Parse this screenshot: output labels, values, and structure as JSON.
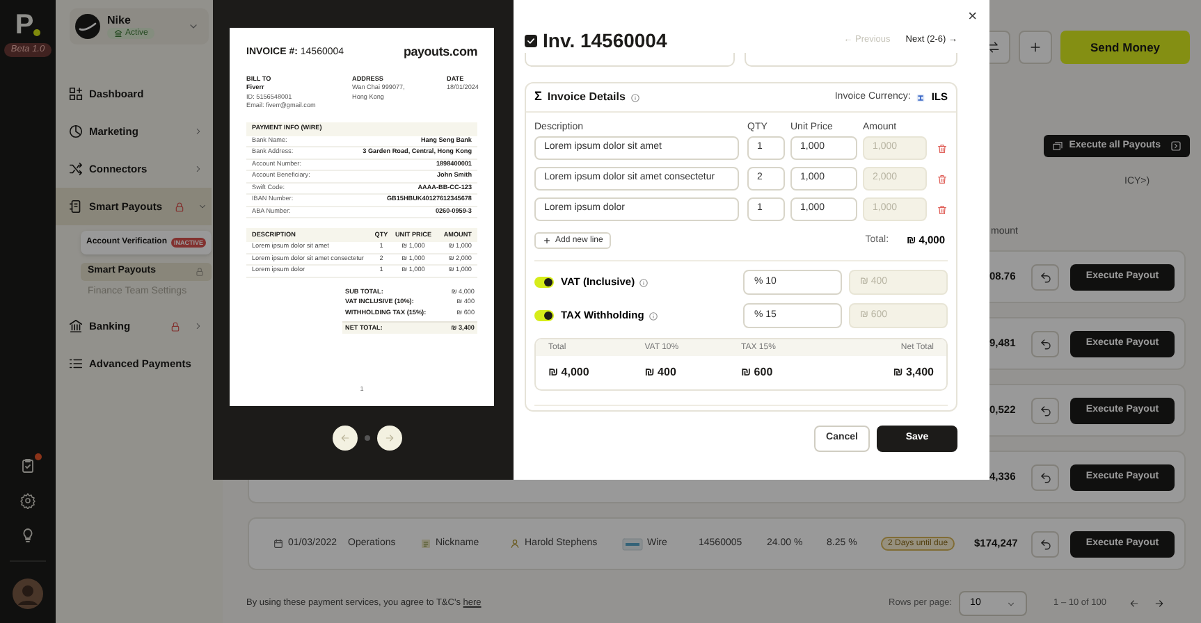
{
  "rail": {
    "logo": "P",
    "version": "Beta 1.0",
    "notification": true
  },
  "account": {
    "name": "Nike",
    "status": "Active"
  },
  "nav": [
    {
      "label": "Dashboard",
      "expandable": false,
      "expanded": false,
      "locked": false,
      "selected": false
    },
    {
      "label": "Marketing",
      "expandable": true,
      "expanded": false,
      "locked": false,
      "selected": false
    },
    {
      "label": "Connectors",
      "expandable": true,
      "expanded": false,
      "locked": false,
      "selected": false
    },
    {
      "label": "Smart Payouts",
      "expandable": true,
      "expanded": true,
      "locked": true,
      "selected": true,
      "children": [
        {
          "label": "Account Verification",
          "kind": "card",
          "badge": "INACTIVE",
          "locked": false,
          "selected": false,
          "disabled": false
        },
        {
          "label": "Smart Payouts",
          "kind": "link",
          "locked": true,
          "selected": true,
          "disabled": false
        },
        {
          "label": "Finance Team Settings",
          "kind": "link",
          "locked": false,
          "selected": false,
          "disabled": true
        }
      ]
    },
    {
      "label": "Banking",
      "expandable": true,
      "expanded": false,
      "locked": true,
      "selected": false
    },
    {
      "label": "Advanced Payments",
      "expandable": false,
      "expanded": false,
      "locked": false,
      "selected": false
    }
  ],
  "toolbar": {
    "send_money": "Send Money",
    "execute_all": "Execute all Payouts"
  },
  "table": {
    "column_fragment": "ICY>)",
    "amount_header_fragment": "mount",
    "rows": [
      {
        "amount": "08.76",
        "action": "Execute Payout"
      },
      {
        "amount": "9,481",
        "action": "Execute Payout"
      },
      {
        "amount": "0,522",
        "action": "Execute Payout"
      },
      {
        "amount": "4,336",
        "action": "Execute Payout"
      },
      {
        "date": "01/03/2022",
        "department": "Operations",
        "nickname": "Nickname",
        "payee": "Harold Stephens",
        "method": "Wire",
        "invoice": "14560005",
        "vat": "24.00 %",
        "tax": "8.25 %",
        "due": "2 Days until due",
        "amount": "$174,247",
        "action": "Execute Payout"
      }
    ]
  },
  "footer": {
    "terms": "By using these payment services, you agree to T&C's",
    "terms_link": "here",
    "rows_label": "Rows per page:",
    "rows_value": "10",
    "range": "1 – 10 of 100"
  },
  "modal": {
    "close": "×",
    "preview": {
      "invoice_label": "INVOICE #:",
      "invoice_number": "14560004",
      "brand": "payouts.com",
      "bill_to": {
        "label": "BILL TO",
        "name": "Fiverr",
        "lines": [
          "ID: 5156548001",
          "Email: fiverr@gmail.com"
        ]
      },
      "address": {
        "label": "ADDRESS",
        "lines": [
          "Wan Chai 999077,",
          "Hong Kong"
        ]
      },
      "date": {
        "label": "DATE",
        "lines": [
          "18/01/2024"
        ]
      },
      "payment_title": "PAYMENT INFO (WIRE)",
      "payment_rows": [
        {
          "label": "Bank Name:",
          "value": "Hang Seng Bank"
        },
        {
          "label": "Bank Address:",
          "value": "3 Garden Road, Central, Hong Kong"
        },
        {
          "label": "Account Number:",
          "value": "1898400001"
        },
        {
          "label": "Account Beneficiary:",
          "value": "John Smith"
        },
        {
          "label": "Swift Code:",
          "value": "AAAA-BB-CC-123"
        },
        {
          "label": "IBAN Number:",
          "value": "GB15HBUK40127612345678"
        },
        {
          "label": "ABA Number:",
          "value": "0260-0959-3"
        }
      ],
      "item_columns": [
        "DESCRIPTION",
        "QTY",
        "UNIT PRICE",
        "AMOUNT"
      ],
      "items": [
        {
          "description": "Lorem ipsum dolor sit amet",
          "qty": "1",
          "unit_price": "₪ 1,000",
          "amount": "₪ 1,000"
        },
        {
          "description": "Lorem ipsum dolor sit amet consectetur",
          "qty": "2",
          "unit_price": "₪ 1,000",
          "amount": "₪ 2,000"
        },
        {
          "description": "Lorem ipsum dolor",
          "qty": "1",
          "unit_price": "₪ 1,000",
          "amount": "₪ 1,000"
        }
      ],
      "totals": [
        {
          "label": "SUB TOTAL:",
          "value": "₪ 4,000"
        },
        {
          "label": "VAT INCLUSIVE (10%):",
          "value": "₪ 400"
        },
        {
          "label": "WITHHOLDING TAX (15%):",
          "value": "₪ 600"
        }
      ],
      "net_total": {
        "label": "NET TOTAL:",
        "value": "₪ 3,400"
      },
      "page": "1"
    },
    "form": {
      "checked": true,
      "title": "Inv. 14560004",
      "previous": {
        "label": "← Previous",
        "disabled": true
      },
      "next": {
        "label": "Next (2-6) →",
        "disabled": false
      },
      "details": {
        "symbol": "Σ",
        "title": "Invoice Details",
        "currency_label": "Invoice Currency:",
        "currency": "ILS",
        "columns": [
          "Description",
          "QTY",
          "Unit Price",
          "Amount"
        ],
        "lines": [
          {
            "description": "Lorem ipsum dolor sit amet",
            "qty": "1",
            "unit_price": "1,000",
            "amount": "1,000"
          },
          {
            "description": "Lorem ipsum dolor sit amet consectetur",
            "qty": "2",
            "unit_price": "1,000",
            "amount": "2,000"
          },
          {
            "description": "Lorem ipsum dolor",
            "qty": "1",
            "unit_price": "1,000",
            "amount": "1,000"
          }
        ],
        "add_line": "Add new line",
        "total_label": "Total:",
        "total": "₪ 4,000"
      },
      "taxes": [
        {
          "label": "VAT (Inclusive)",
          "on": true,
          "rate": "% 10",
          "amount": "₪ 400"
        },
        {
          "label": "TAX Withholding",
          "on": true,
          "rate": "% 15",
          "amount": "₪ 600"
        }
      ],
      "summary": [
        {
          "label": "Total",
          "value": "₪ 4,000"
        },
        {
          "label": "VAT 10%",
          "value": "₪ 400"
        },
        {
          "label": "TAX 15%",
          "value": "₪ 600"
        },
        {
          "label": "Net Total",
          "value": "₪ 3,400"
        }
      ],
      "cancel": "Cancel",
      "save": "Save"
    }
  }
}
